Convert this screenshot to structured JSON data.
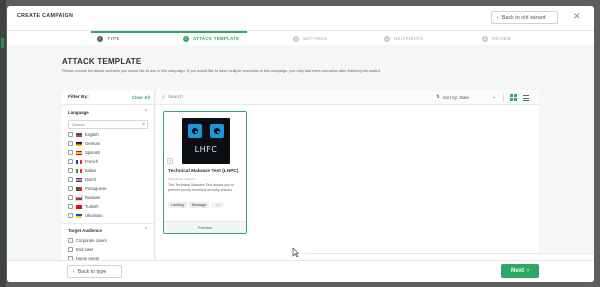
{
  "modal": {
    "title": "CREATE CAMPAIGN",
    "back_old_wizard": "Back to old wizard",
    "close_icon": "close-icon"
  },
  "steps": [
    {
      "label": "TYPE",
      "number": "✓",
      "state": "done"
    },
    {
      "label": "ATTACK TEMPLATE",
      "number": "2",
      "state": "active"
    },
    {
      "label": "SETTINGS",
      "number": "3",
      "state": "pending"
    },
    {
      "label": "RECIPIENTS",
      "number": "4",
      "state": "pending"
    },
    {
      "label": "REVIEW",
      "number": "5",
      "state": "pending"
    }
  ],
  "page": {
    "title": "ATTACK TEMPLATE",
    "description": "Please choose the attack scenario you would like to use in this campaign. If you would like to have multiple scenarios in this campaign, you may add extra scenarios after finishing the wizard."
  },
  "filter": {
    "title": "Filter By:",
    "clear_all": "Clear All",
    "language": {
      "heading": "Language",
      "search_placeholder": "Search",
      "options": [
        {
          "label": "English",
          "flag": "flag-us"
        },
        {
          "label": "German",
          "flag": "flag-de"
        },
        {
          "label": "Spanish",
          "flag": "flag-es"
        },
        {
          "label": "French",
          "flag": "flag-fr"
        },
        {
          "label": "Italian",
          "flag": "flag-it"
        },
        {
          "label": "Dutch",
          "flag": "flag-nl"
        },
        {
          "label": "Portuguese",
          "flag": "flag-pt"
        },
        {
          "label": "Russian",
          "flag": "flag-ru"
        },
        {
          "label": "Turkish",
          "flag": "flag-tr"
        },
        {
          "label": "Ukrainian",
          "flag": "flag-ua"
        }
      ]
    },
    "audience": {
      "heading": "Target Audience",
      "options": [
        {
          "label": "Corporate Users"
        },
        {
          "label": "End User"
        },
        {
          "label": "Home Users"
        }
      ]
    }
  },
  "toolbar": {
    "search_placeholder": "Search",
    "sort_label": "Sort by: Date"
  },
  "cards": [
    {
      "title": "Technical Malware Text (LHPC)",
      "date": "2024-04-12 16:22:01",
      "description": "The Technical Malware Text allows you to perform purely technical security checks",
      "image_text": "LHFC",
      "badge": "1",
      "tags": [
        "Landing",
        "Message",
        "Link"
      ],
      "preview": "Preview"
    }
  ],
  "footer": {
    "back_label": "Back to type",
    "next_label": "Next"
  },
  "colors": {
    "accent": "#2fa866",
    "icon_blue": "#1d96d3"
  }
}
